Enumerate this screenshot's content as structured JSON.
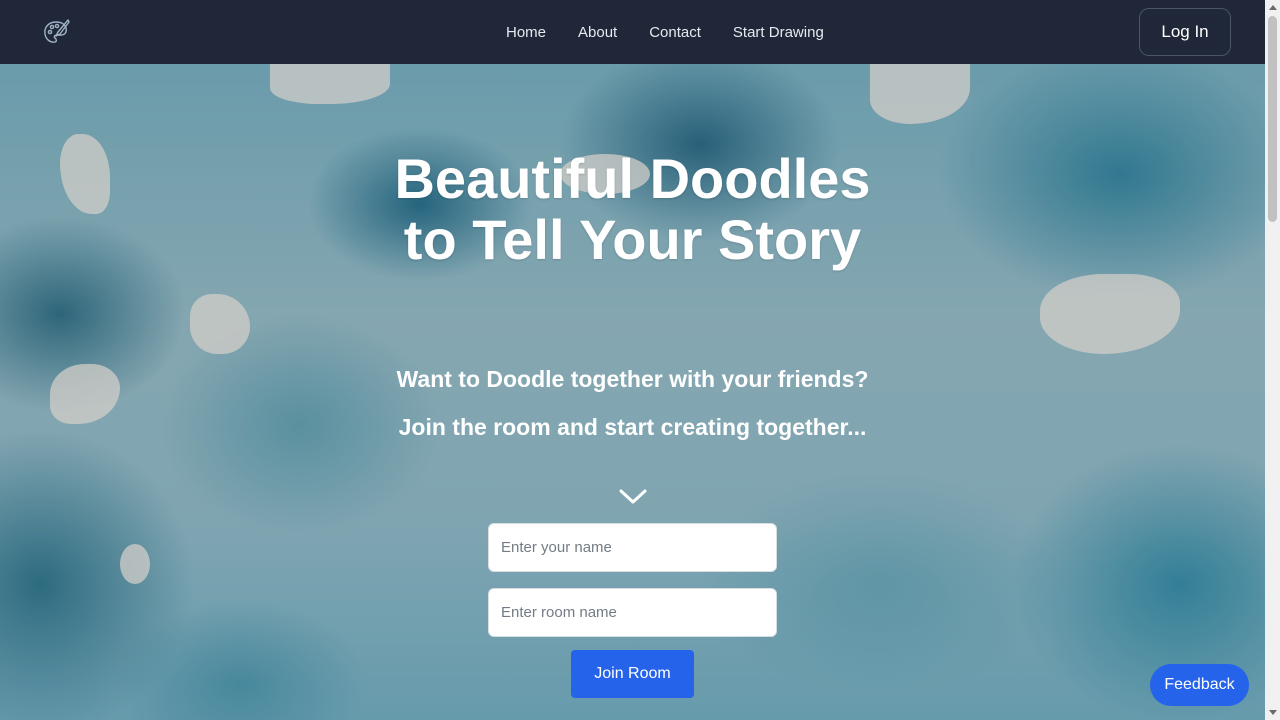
{
  "nav": {
    "logo_icon": "paint-palette-brush-icon",
    "links": [
      {
        "label": "Home"
      },
      {
        "label": "About"
      },
      {
        "label": "Contact"
      },
      {
        "label": "Start Drawing"
      }
    ],
    "login_label": "Log In"
  },
  "hero": {
    "title_line1": "Beautiful Doodles",
    "title_line2": "to Tell Your Story",
    "subtitle1": "Want to Doodle together with your friends?",
    "subtitle2": "Join the room and start creating together...",
    "chevron_icon": "chevron-down-icon"
  },
  "form": {
    "name_placeholder": "Enter your name",
    "room_placeholder": "Enter room name",
    "join_label": "Join Room"
  },
  "feedback_label": "Feedback",
  "colors": {
    "navbar": "#1f2738",
    "primary_button": "#2563eb",
    "hero_teal": "#1f6f8b"
  }
}
